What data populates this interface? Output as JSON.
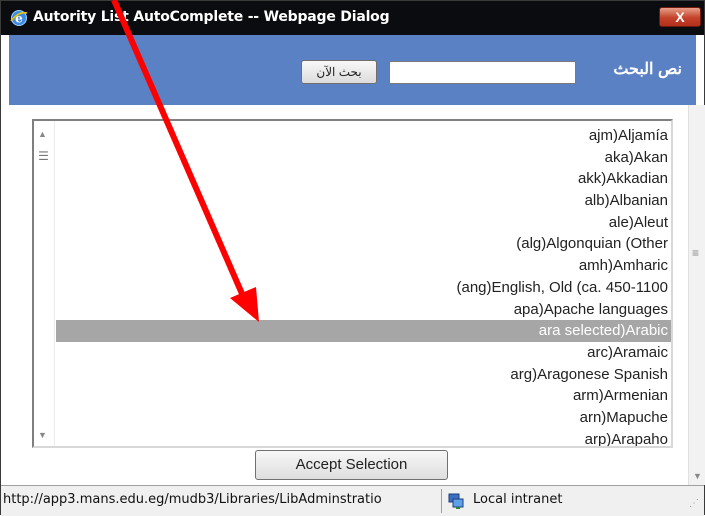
{
  "window": {
    "title": "Autority List AutoComplete -- Webpage Dialog",
    "close_label": "X"
  },
  "search": {
    "label": "نص البحث",
    "input_value": "",
    "button_label": "بحث الآن"
  },
  "list": {
    "items": [
      {
        "text": "ajm)Aljamía",
        "selected": false
      },
      {
        "text": "aka)Akan",
        "selected": false
      },
      {
        "text": "akk)Akkadian",
        "selected": false
      },
      {
        "text": "alb)Albanian",
        "selected": false
      },
      {
        "text": "ale)Aleut",
        "selected": false
      },
      {
        "text": "(alg)Algonquian (Other",
        "selected": false
      },
      {
        "text": "amh)Amharic",
        "selected": false
      },
      {
        "text": "(ang)English, Old (ca. 450-1100",
        "selected": false
      },
      {
        "text": "apa)Apache languages",
        "selected": false
      },
      {
        "text": "ara selected)Arabic",
        "selected": true
      },
      {
        "text": "arc)Aramaic",
        "selected": false
      },
      {
        "text": "arg)Aragonese Spanish",
        "selected": false
      },
      {
        "text": "arm)Armenian",
        "selected": false
      },
      {
        "text": "arn)Mapuche",
        "selected": false
      },
      {
        "text": "arp)Arapaho",
        "selected": false
      }
    ]
  },
  "accept_button_label": "Accept Selection",
  "statusbar": {
    "url": "http://app3.mans.edu.eg/mudb3/Libraries/LibAdminstratio",
    "zone": "Local intranet"
  },
  "colors": {
    "titlebar": "#0b0c10",
    "search_band": "#5b81c5",
    "selected_row": "#a6a6a6",
    "arrow": "#ff0000",
    "close_button": "#c4412a"
  },
  "icons": {
    "window": "ie-icon",
    "zone": "network-icon"
  }
}
